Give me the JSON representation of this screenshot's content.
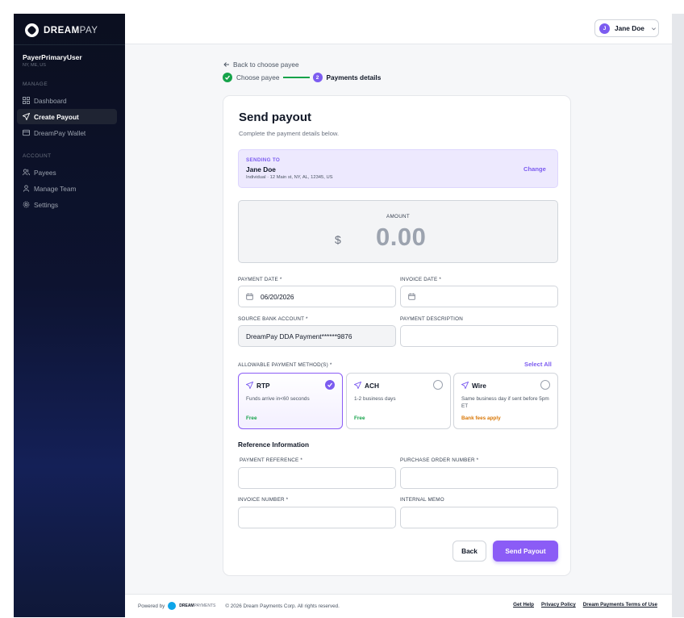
{
  "brand": {
    "bold": "DREAM",
    "light": "PAY"
  },
  "sidebar": {
    "user_name": "PayerPrimaryUser",
    "user_location": "NY, ME, US",
    "manage_label": "MANAGE",
    "account_label": "ACCOUNT",
    "manage_items": [
      {
        "label": "Dashboard",
        "icon": "grid-icon"
      },
      {
        "label": "Create Payout",
        "icon": "send-icon",
        "active": true
      },
      {
        "label": "DreamPay Wallet",
        "icon": "wallet-icon"
      }
    ],
    "account_items": [
      {
        "label": "Payees",
        "icon": "users-icon"
      },
      {
        "label": "Manage Team",
        "icon": "user-icon"
      },
      {
        "label": "Settings",
        "icon": "gear-icon"
      }
    ]
  },
  "header": {
    "avatar_initial": "J",
    "user_name": "Jane Doe"
  },
  "nav": {
    "back_link": "Back to choose payee",
    "step1_label": "Choose payee",
    "step2_number": "2",
    "step2_label": "Payments details"
  },
  "form": {
    "title": "Send payout",
    "subtitle": "Complete the payment details below.",
    "sending_to": {
      "label": "SENDING TO",
      "name": "Jane Doe",
      "address": "Individual · 12 Main st, NY, AL, 12345, US",
      "change_label": "Change"
    },
    "amount": {
      "label": "AMOUNT",
      "currency": "$",
      "value": "0.00"
    },
    "payment_date": {
      "label": "PAYMENT DATE *",
      "value": "06/20/2026"
    },
    "invoice_date": {
      "label": "INVOICE DATE *",
      "value": ""
    },
    "source_bank": {
      "label": "SOURCE BANK ACCOUNT *",
      "value": "DreamPay DDA Payment******9876"
    },
    "payment_description": {
      "label": "PAYMENT DESCRIPTION",
      "value": ""
    },
    "methods_label": "ALLOWABLE PAYMENT METHOD(S) *",
    "select_all": "Select All",
    "methods": [
      {
        "name": "RTP",
        "desc": "Funds arrive in<60 seconds",
        "fee": "Free",
        "fee_color": "#16a34a",
        "selected": true
      },
      {
        "name": "ACH",
        "desc": "1-2 business days",
        "fee": "Free",
        "fee_color": "#16a34a",
        "selected": false
      },
      {
        "name": "Wire",
        "desc": "Same business day if sent before 5pm ET",
        "fee": "Bank fees apply",
        "fee_color": "#d97706",
        "selected": false
      }
    ],
    "reference_title": "Reference Information",
    "payment_reference": {
      "label": "PAYMENT REFERENCE *",
      "value": ""
    },
    "purchase_order": {
      "label": "PURCHASE ORDER NUMBER *",
      "value": ""
    },
    "invoice_number": {
      "label": "INVOICE NUMBER *",
      "value": ""
    },
    "internal_memo": {
      "label": "INTERNAL MEMO",
      "value": ""
    },
    "back_button": "Back",
    "send_button": "Send Payout"
  },
  "footer": {
    "powered_by": "Powered by",
    "mini_brand_bold": "DREAM",
    "mini_brand_light": "PAYMENTS",
    "copyright": "© 2026 Dream Payments Corp. All rights reserved.",
    "links": [
      "Get Help",
      "Privacy Policy",
      "Dream Payments Terms of Use"
    ]
  },
  "colors": {
    "accent": "#7c5cf0",
    "success": "#16a34a",
    "warning": "#d97706",
    "sidebar": "#0b0f1f"
  }
}
